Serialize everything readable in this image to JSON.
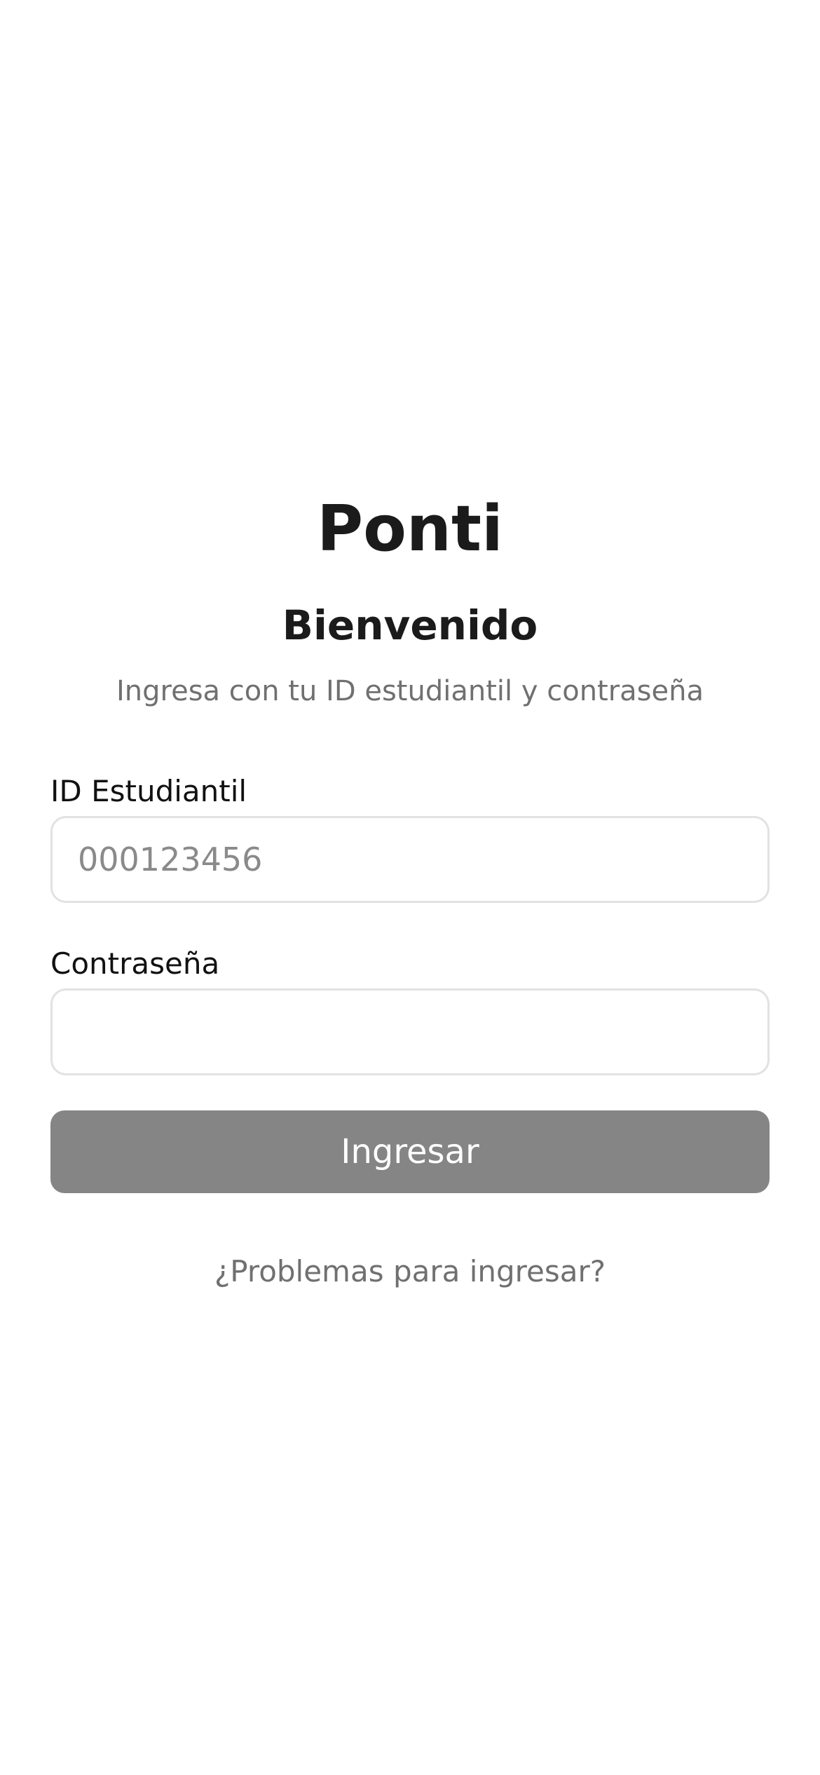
{
  "app": {
    "title": "Ponti"
  },
  "login": {
    "heading": "Bienvenido",
    "subtitle": "Ingresa con tu ID estudiantil y contraseña",
    "student_id": {
      "label": "ID Estudiantil",
      "value": "",
      "placeholder": "000123456"
    },
    "password": {
      "label": "Contraseña",
      "value": "",
      "placeholder": ""
    },
    "submit_label": "Ingresar",
    "help_link": "¿Problemas para ingresar?"
  },
  "colors": {
    "background": "#ffffff",
    "text_primary": "#1b1b1b",
    "text_secondary": "#707070",
    "input_border": "#e2e2e2",
    "button_disabled": "#858585",
    "button_text": "#ffffff"
  }
}
